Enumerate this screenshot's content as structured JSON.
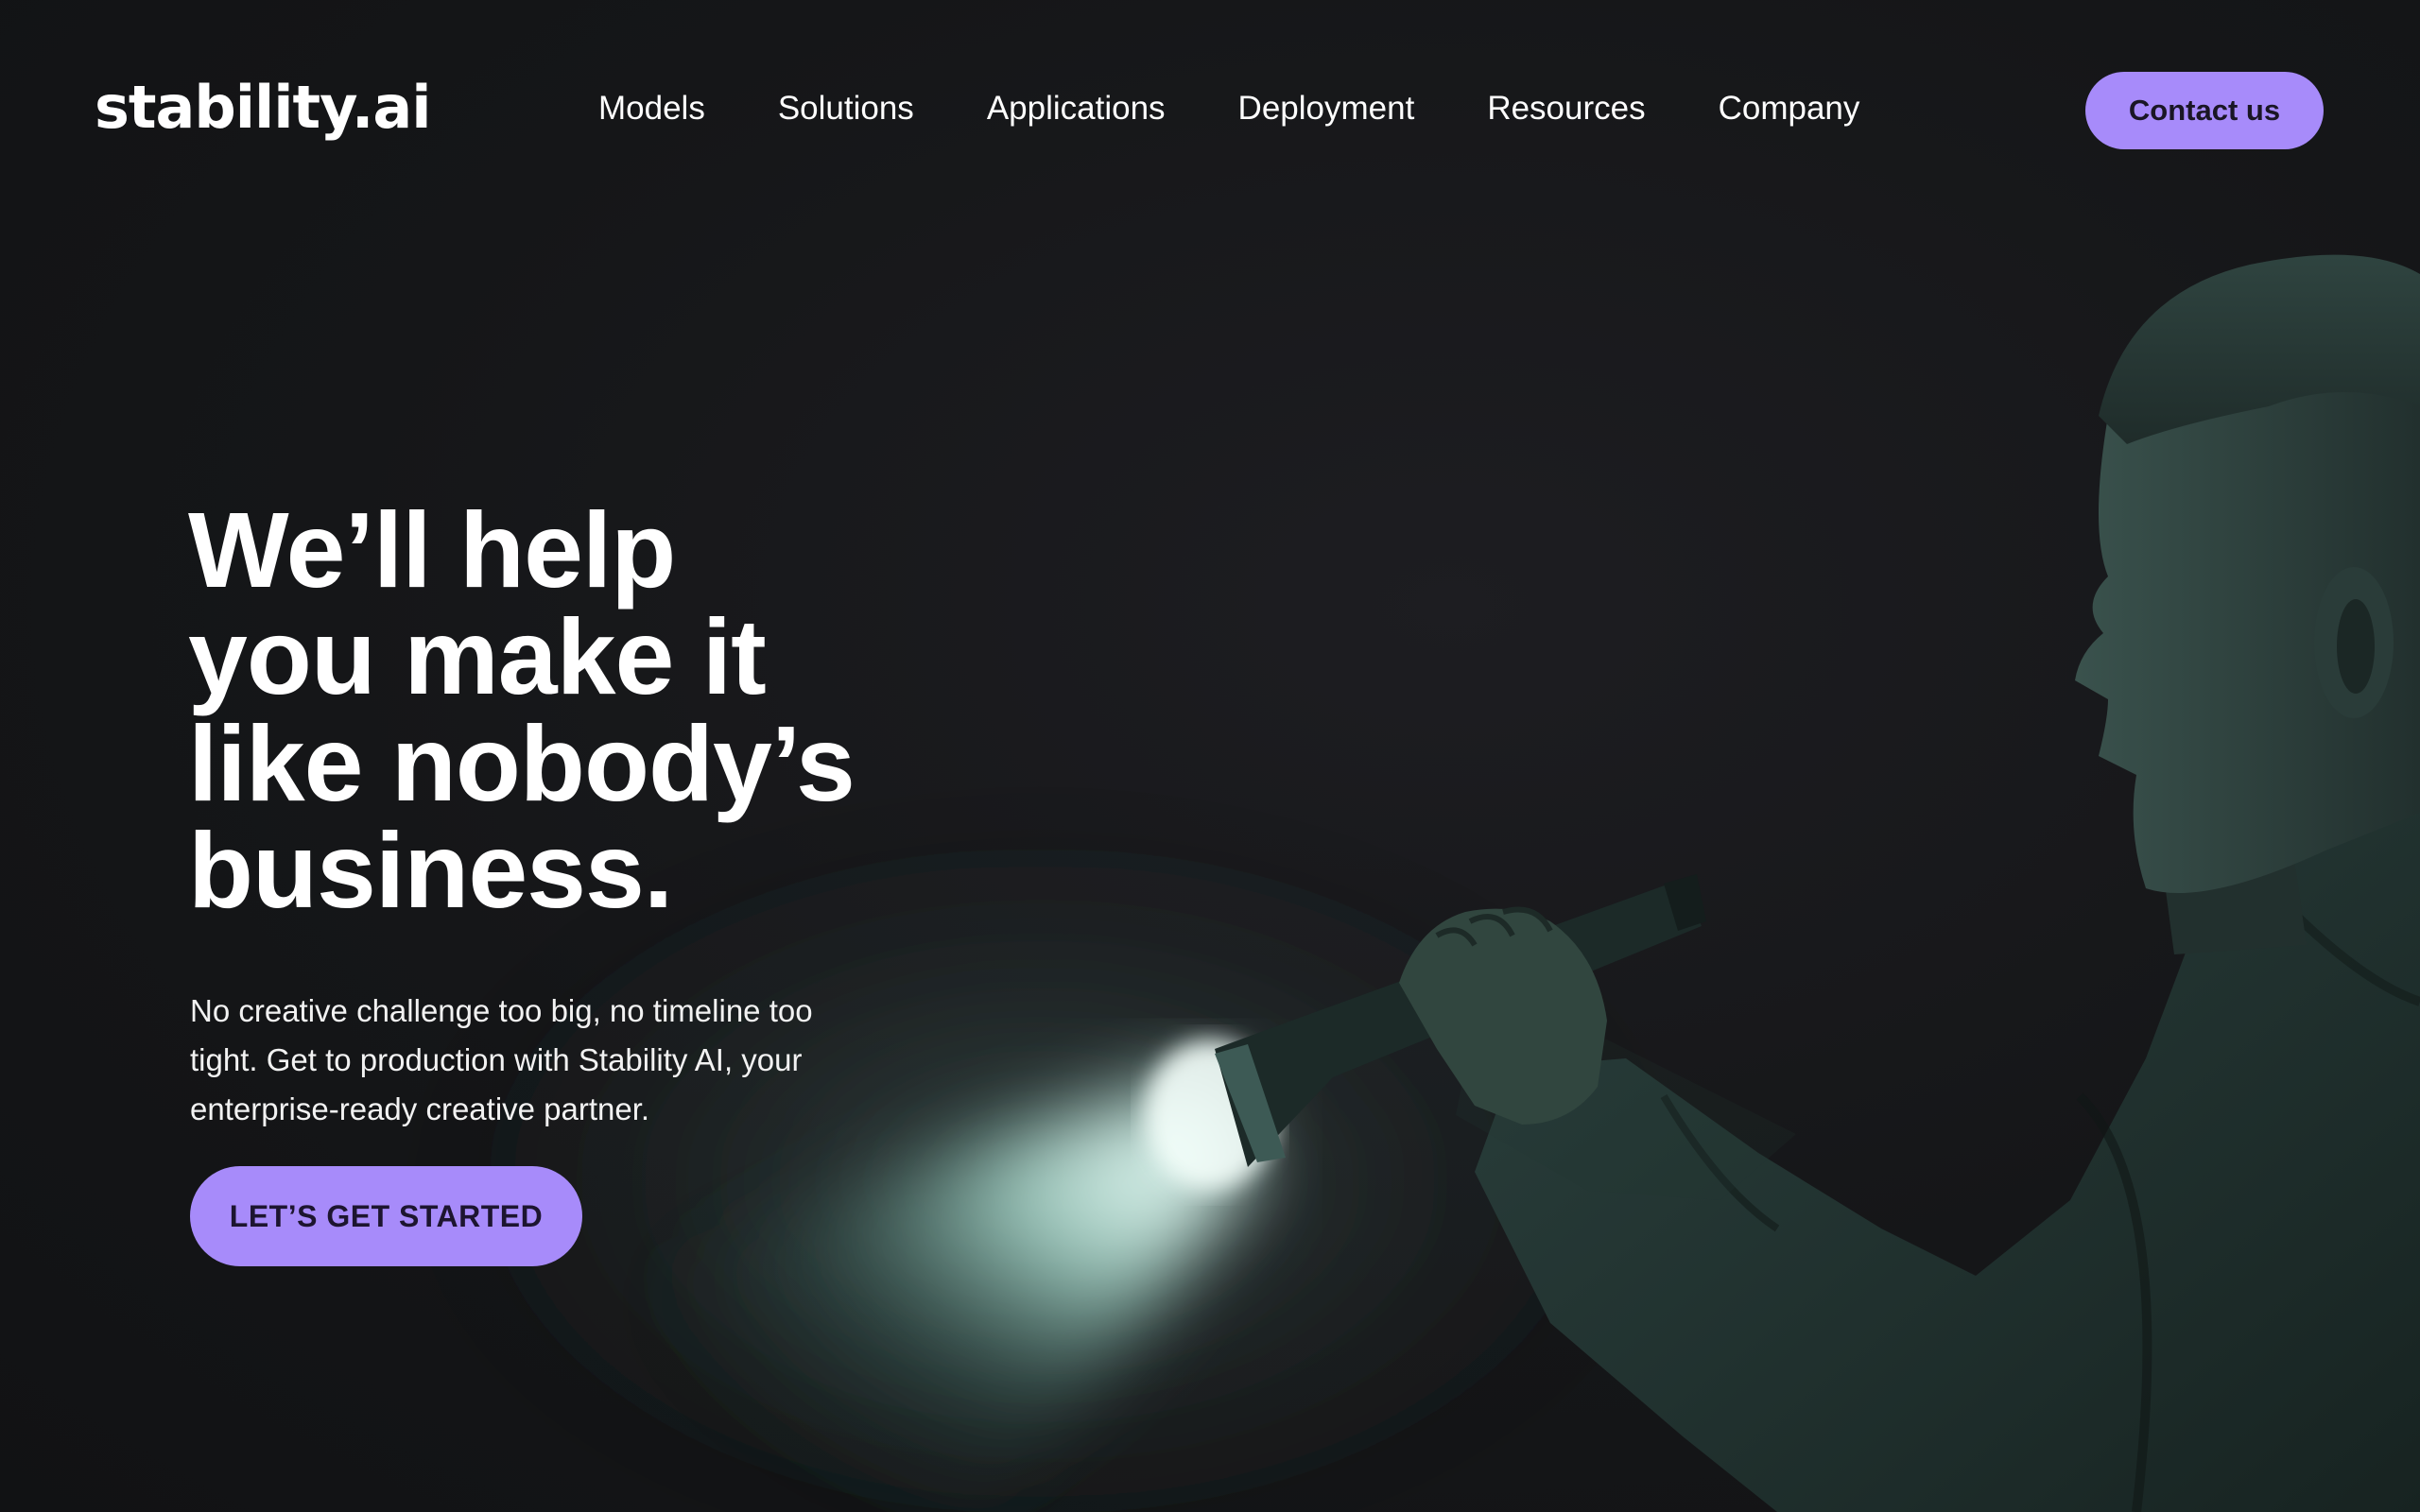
{
  "brand": {
    "logo_text": "stability.ai",
    "accent_color": "#a78bfa"
  },
  "nav": {
    "items": [
      {
        "label": "Models"
      },
      {
        "label": "Solutions"
      },
      {
        "label": "Applications"
      },
      {
        "label": "Deployment"
      },
      {
        "label": "Resources"
      },
      {
        "label": "Company"
      }
    ],
    "contact_label": "Contact us"
  },
  "hero": {
    "title_lines": [
      "We’ll help",
      "you make it",
      "like nobody’s",
      "business."
    ],
    "subtitle": "No creative challenge too big, no timeline too tight. Get to production with Stability AI, your enterprise-ready creative partner.",
    "cta_label": "LET’S GET STARTED"
  }
}
